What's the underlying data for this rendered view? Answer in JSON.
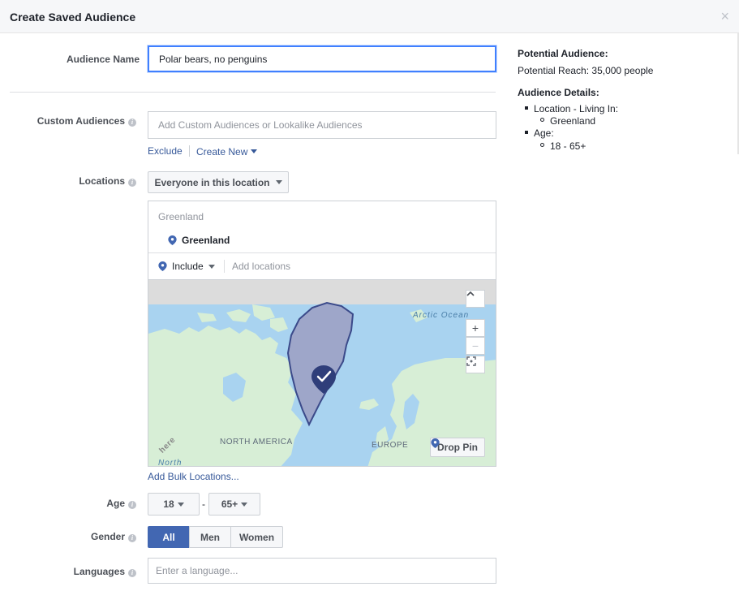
{
  "dialog": {
    "title": "Create Saved Audience",
    "close_symbol": "×"
  },
  "form": {
    "audience_name": {
      "label": "Audience Name",
      "value": "Polar bears, no penguins"
    },
    "custom_audiences": {
      "label": "Custom Audiences",
      "placeholder": "Add Custom Audiences or Lookalike Audiences",
      "exclude_label": "Exclude",
      "create_new_label": "Create New"
    },
    "locations": {
      "label": "Locations",
      "dropdown_value": "Everyone in this location",
      "country_header": "Greenland",
      "selected_place": "Greenland",
      "include_label": "Include",
      "add_placeholder": "Add locations",
      "bulk_link": "Add Bulk Locations..."
    },
    "map": {
      "labels": {
        "arctic": "Arctic Ocean",
        "north_america": "NORTH AMERICA",
        "europe": "EUROPE",
        "watermark": "here",
        "north": "North"
      },
      "controls": {
        "up": "⌃",
        "zoom_in": "+",
        "zoom_out": "−"
      },
      "drop_pin_label": "Drop Pin",
      "colors": {
        "ocean": "#a9d3f0",
        "land": "#d7eed6",
        "greenland": "#9ea6c9",
        "pin": "#2f3e7a"
      }
    },
    "age": {
      "label": "Age",
      "min": "18",
      "separator": "-",
      "max": "65+"
    },
    "gender": {
      "label": "Gender",
      "options": [
        "All",
        "Men",
        "Women"
      ],
      "selected": "All"
    },
    "languages": {
      "label": "Languages",
      "placeholder": "Enter a language..."
    }
  },
  "summary": {
    "potential_heading": "Potential Audience:",
    "reach_text": "Potential Reach: 35,000 people",
    "details_heading": "Audience Details:",
    "location_item": "Location - Living In:",
    "location_sub": "Greenland",
    "age_item": "Age:",
    "age_sub": "18 - 65+"
  },
  "colors": {
    "accent": "#4267b2",
    "link": "#365899",
    "focus": "#4080ff"
  }
}
